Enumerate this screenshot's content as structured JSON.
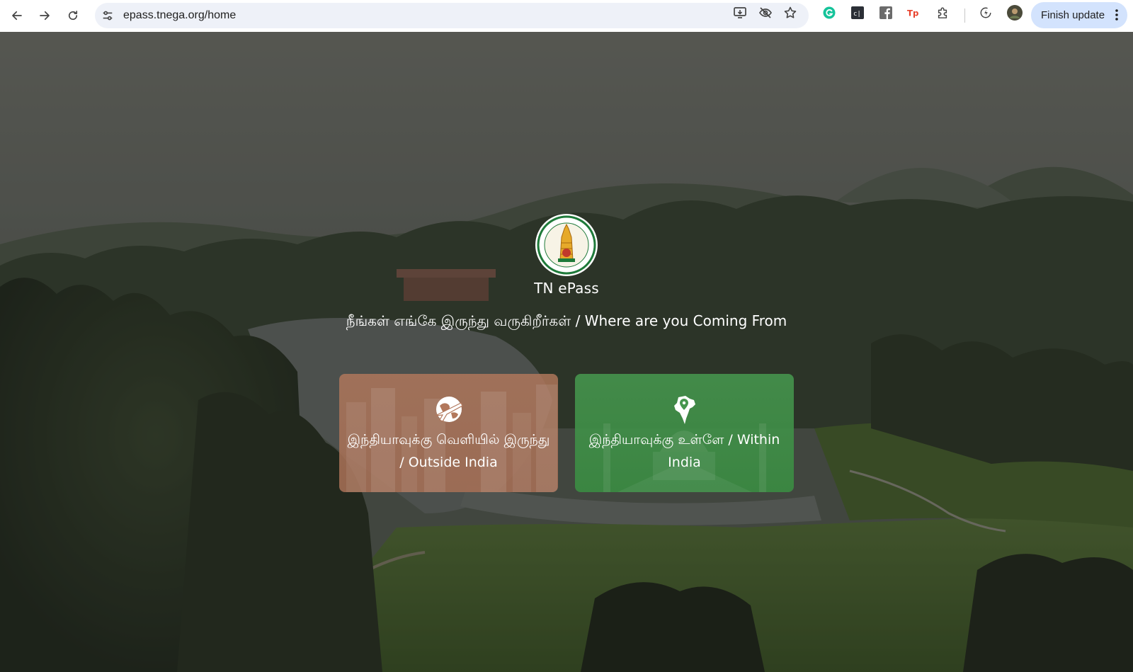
{
  "browser": {
    "url": "epass.tnega.org/home",
    "finish_update_label": "Finish update",
    "icons": [
      "back-arrow-icon",
      "forward-arrow-icon",
      "reload-icon",
      "site-settings-icon",
      "install-app-icon",
      "eye-off-icon",
      "bookmark-star-icon",
      "grammarly-icon",
      "colorzilla-icon",
      "facebook-icon",
      "tp-extension-icon",
      "extensions-puzzle-icon",
      "performance-icon",
      "profile-avatar-icon",
      "more-menu-icon"
    ],
    "extensions": {
      "colorzilla_text": "c|",
      "tp_text": "Tp"
    }
  },
  "page": {
    "site_title": "TN ePass",
    "question": "நீங்கள் எங்கே இருந்து வருகிறீர்கள் / Where are you Coming From",
    "options": [
      {
        "label": "இந்தியாவுக்கு வெளியில் இருந்து / Outside India",
        "icon": "globe-plane-icon",
        "color": "#b2785c"
      },
      {
        "label": "இந்தியாவுக்கு உள்ளே / Within India",
        "icon": "india-map-pin-icon",
        "color": "#46964e"
      }
    ]
  }
}
